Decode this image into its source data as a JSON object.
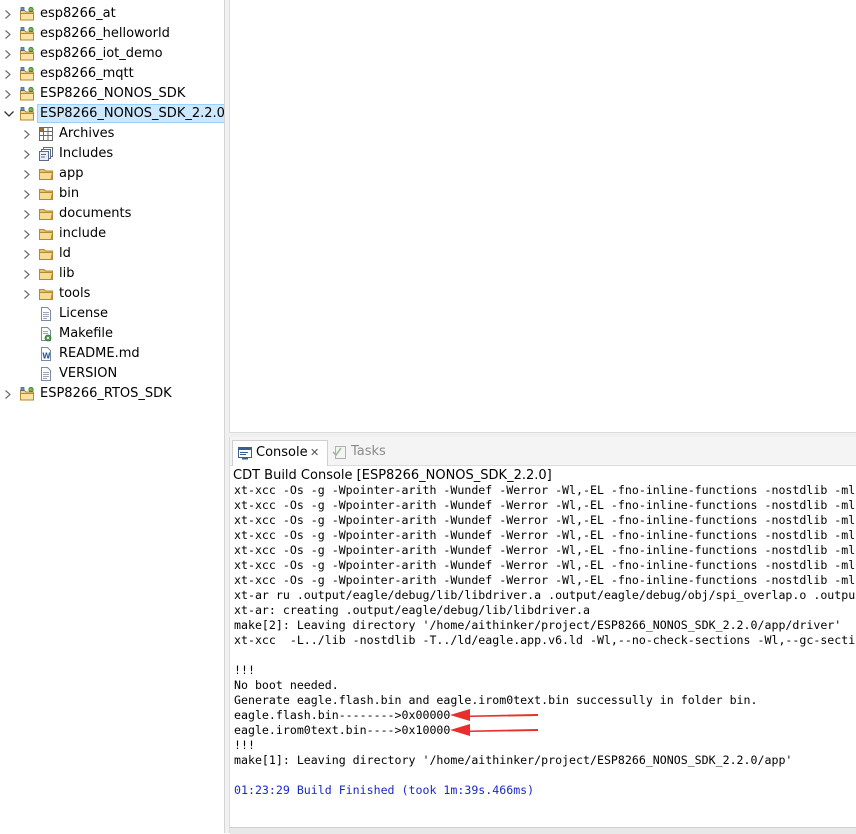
{
  "project_tree": {
    "items": [
      {
        "label": "esp8266_at",
        "expandable": true,
        "expanded": false,
        "icon": "project-folder-icon"
      },
      {
        "label": "esp8266_helloworld",
        "expandable": true,
        "expanded": false,
        "icon": "project-folder-icon"
      },
      {
        "label": "esp8266_iot_demo",
        "expandable": true,
        "expanded": false,
        "icon": "project-folder-icon"
      },
      {
        "label": "esp8266_mqtt",
        "expandable": true,
        "expanded": false,
        "icon": "project-folder-icon"
      },
      {
        "label": "ESP8266_NONOS_SDK",
        "expandable": true,
        "expanded": false,
        "icon": "project-folder-icon"
      },
      {
        "label": "ESP8266_NONOS_SDK_2.2.0",
        "expandable": true,
        "expanded": true,
        "selected": true,
        "icon": "project-folder-icon"
      },
      {
        "label": "Archives",
        "expandable": true,
        "expanded": false,
        "icon": "archives-icon",
        "child": true
      },
      {
        "label": "Includes",
        "expandable": true,
        "expanded": false,
        "icon": "includes-icon",
        "child": true
      },
      {
        "label": "app",
        "expandable": true,
        "expanded": false,
        "icon": "folder-icon",
        "child": true
      },
      {
        "label": "bin",
        "expandable": true,
        "expanded": false,
        "icon": "folder-icon",
        "child": true
      },
      {
        "label": "documents",
        "expandable": true,
        "expanded": false,
        "icon": "folder-icon",
        "child": true
      },
      {
        "label": "include",
        "expandable": true,
        "expanded": false,
        "icon": "folder-icon",
        "child": true
      },
      {
        "label": "ld",
        "expandable": true,
        "expanded": false,
        "icon": "folder-icon",
        "child": true
      },
      {
        "label": "lib",
        "expandable": true,
        "expanded": false,
        "icon": "folder-icon",
        "child": true
      },
      {
        "label": "tools",
        "expandable": true,
        "expanded": false,
        "icon": "folder-icon",
        "child": true
      },
      {
        "label": "License",
        "expandable": false,
        "icon": "file-icon",
        "child": true
      },
      {
        "label": "Makefile",
        "expandable": false,
        "icon": "makefile-icon",
        "child": true
      },
      {
        "label": "README.md",
        "expandable": false,
        "icon": "word-file-icon",
        "child": true
      },
      {
        "label": "VERSION",
        "expandable": false,
        "icon": "file-icon",
        "child": true
      },
      {
        "label": "ESP8266_RTOS_SDK",
        "expandable": true,
        "expanded": false,
        "icon": "project-folder-icon"
      }
    ]
  },
  "console": {
    "tabs": [
      {
        "label": "Console",
        "active": true,
        "icon": "console-icon",
        "close": "✕"
      },
      {
        "label": "Tasks",
        "active": false,
        "icon": "tasks-icon"
      }
    ],
    "title": "CDT Build Console [ESP8266_NONOS_SDK_2.2.0]",
    "lines": [
      {
        "text": "xt-xcc -Os -g -Wpointer-arith -Wundef -Werror -Wl,-EL -fno-inline-functions -nostdlib -mlo",
        "blue": false
      },
      {
        "text": "xt-xcc -Os -g -Wpointer-arith -Wundef -Werror -Wl,-EL -fno-inline-functions -nostdlib -mlo",
        "blue": false
      },
      {
        "text": "xt-xcc -Os -g -Wpointer-arith -Wundef -Werror -Wl,-EL -fno-inline-functions -nostdlib -mlo",
        "blue": false
      },
      {
        "text": "xt-xcc -Os -g -Wpointer-arith -Wundef -Werror -Wl,-EL -fno-inline-functions -nostdlib -mlo",
        "blue": false
      },
      {
        "text": "xt-xcc -Os -g -Wpointer-arith -Wundef -Werror -Wl,-EL -fno-inline-functions -nostdlib -mlo",
        "blue": false
      },
      {
        "text": "xt-xcc -Os -g -Wpointer-arith -Wundef -Werror -Wl,-EL -fno-inline-functions -nostdlib -mlo",
        "blue": false
      },
      {
        "text": "xt-xcc -Os -g -Wpointer-arith -Wundef -Werror -Wl,-EL -fno-inline-functions -nostdlib -mlo",
        "blue": false
      },
      {
        "text": "xt-ar ru .output/eagle/debug/lib/libdriver.a .output/eagle/debug/obj/spi_overlap.o .outpu",
        "blue": false
      },
      {
        "text": "xt-ar: creating .output/eagle/debug/lib/libdriver.a",
        "blue": false
      },
      {
        "text": "make[2]: Leaving directory '/home/aithinker/project/ESP8266_NONOS_SDK_2.2.0/app/driver'",
        "blue": false
      },
      {
        "text": "xt-xcc  -L../lib -nostdlib -T../ld/eagle.app.v6.ld -Wl,--no-check-sections -Wl,--gc-secti",
        "blue": false
      },
      {
        "text": "",
        "blue": false
      },
      {
        "text": "!!!",
        "blue": false
      },
      {
        "text": "No boot needed.",
        "blue": false
      },
      {
        "text": "Generate eagle.flash.bin and eagle.irom0text.bin successully in folder bin.",
        "blue": false
      },
      {
        "text": "eagle.flash.bin-------->0x00000",
        "blue": false
      },
      {
        "text": "eagle.irom0text.bin---->0x10000",
        "blue": false
      },
      {
        "text": "!!!",
        "blue": false
      },
      {
        "text": "make[1]: Leaving directory '/home/aithinker/project/ESP8266_NONOS_SDK_2.2.0/app'",
        "blue": false
      },
      {
        "text": "",
        "blue": false
      },
      {
        "text": "01:23:29 Build Finished (took 1m:39s.466ms)",
        "blue": true
      }
    ]
  },
  "colors": {
    "selection_bg": "#cce8ff",
    "build_finished": "#1a28c8",
    "annotation_arrow": "#e8302a"
  }
}
